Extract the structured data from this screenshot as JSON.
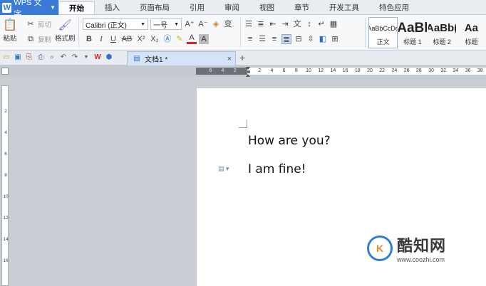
{
  "app": {
    "name": "WPS 文字"
  },
  "menu": {
    "tabs": [
      "开始",
      "插入",
      "页面布局",
      "引用",
      "审阅",
      "视图",
      "章节",
      "开发工具",
      "特色应用"
    ],
    "active": "开始"
  },
  "ribbon": {
    "paste_label": "粘贴",
    "cut_label": "剪切",
    "copy_label": "复制",
    "format_painter_label": "格式刷",
    "font_name": "Calibri (正文)",
    "font_size": "一号",
    "bold": "B",
    "italic": "I",
    "underline": "U",
    "strike": "AB",
    "superscript": "X²",
    "subscript": "X₂",
    "grow_font": "A⁺",
    "shrink_font": "A⁻",
    "font_color_letter": "A",
    "styles": [
      {
        "sample": "AaBbCcDd",
        "name": "正文"
      },
      {
        "sample": "AaBl",
        "name": "标题 1"
      },
      {
        "sample": "AaBb(",
        "name": "标题 2"
      },
      {
        "sample": "Aa",
        "name": "标题"
      }
    ]
  },
  "tabs": {
    "document_tab": "文档1 *",
    "close_glyph": "×",
    "new_tab_glyph": "+"
  },
  "ruler": {
    "left_labels": [
      "6",
      "4",
      "2"
    ],
    "right_labels": [
      "2",
      "4",
      "6",
      "8",
      "10",
      "12",
      "14",
      "16",
      "18",
      "20",
      "22",
      "24",
      "26",
      "28",
      "30",
      "32",
      "34",
      "36",
      "38"
    ],
    "vertical_labels": [
      "2",
      "4",
      "6",
      "8",
      "10",
      "12",
      "14",
      "16"
    ]
  },
  "document": {
    "lines": [
      "How are you?",
      "I am fine!"
    ]
  },
  "watermark": {
    "logo_text": "K",
    "title": "酷知网",
    "url": "www.coozhi.com"
  },
  "colors": {
    "accent": "#3a7bd5",
    "tab_highlight": "#d4e3f7"
  }
}
